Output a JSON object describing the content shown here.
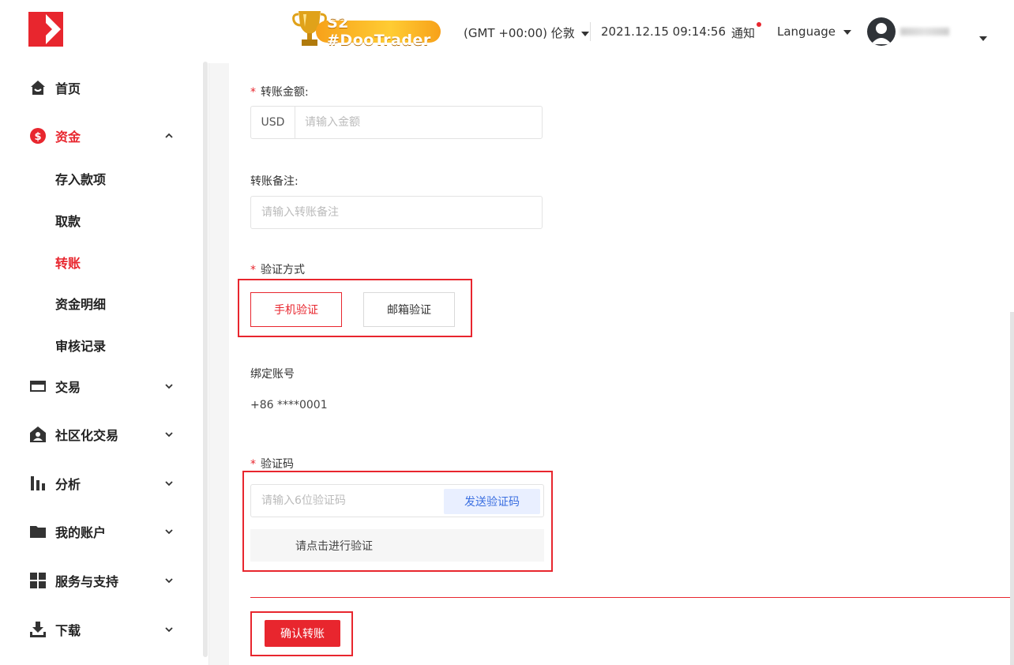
{
  "sidebar": {
    "items": [
      {
        "key": "home",
        "label": "首页",
        "icon": "home-icon"
      },
      {
        "key": "funds",
        "label": "资金",
        "icon": "dollar-circle-icon",
        "expanded": true,
        "active": true
      },
      {
        "key": "trade",
        "label": "交易",
        "icon": "card-icon"
      },
      {
        "key": "social",
        "label": "社区化交易",
        "icon": "social-user-icon"
      },
      {
        "key": "analysis",
        "label": "分析",
        "icon": "bar-chart-icon"
      },
      {
        "key": "accounts",
        "label": "我的账户",
        "icon": "folder-icon"
      },
      {
        "key": "support",
        "label": "服务与支持",
        "icon": "grid-icon"
      },
      {
        "key": "download",
        "label": "下载",
        "icon": "download-icon"
      }
    ],
    "sub_items": [
      {
        "label": "存入款项"
      },
      {
        "label": "取款"
      },
      {
        "label": "转账",
        "active": true
      },
      {
        "label": "资金明细"
      },
      {
        "label": "审核记录"
      }
    ]
  },
  "header": {
    "banner_text": "S2 #DooTrader",
    "timezone": "(GMT +00:00) 伦敦",
    "datetime": "2021.12.15 09:14:56",
    "notice": "通知",
    "language": "Language"
  },
  "form": {
    "amount": {
      "label": "转账金额:",
      "currency": "USD",
      "placeholder": "请输入金额",
      "value": ""
    },
    "remark": {
      "label": "转账备注:",
      "placeholder": "请输入转账备注",
      "value": ""
    },
    "method": {
      "label": "验证方式",
      "options": [
        "手机验证",
        "邮箱验证"
      ],
      "selected": "手机验证"
    },
    "bound": {
      "label": "绑定账号",
      "value": "+86 ****0001"
    },
    "code": {
      "label": "验证码",
      "placeholder": "请输入6位验证码",
      "value": "",
      "send_label": "发送验证码"
    },
    "captcha_label": "请点击进行验证",
    "confirm_label": "确认转账"
  },
  "colors": {
    "accent": "#e8262e",
    "send_bg": "#e9efff",
    "send_text": "#3b6fe0"
  }
}
